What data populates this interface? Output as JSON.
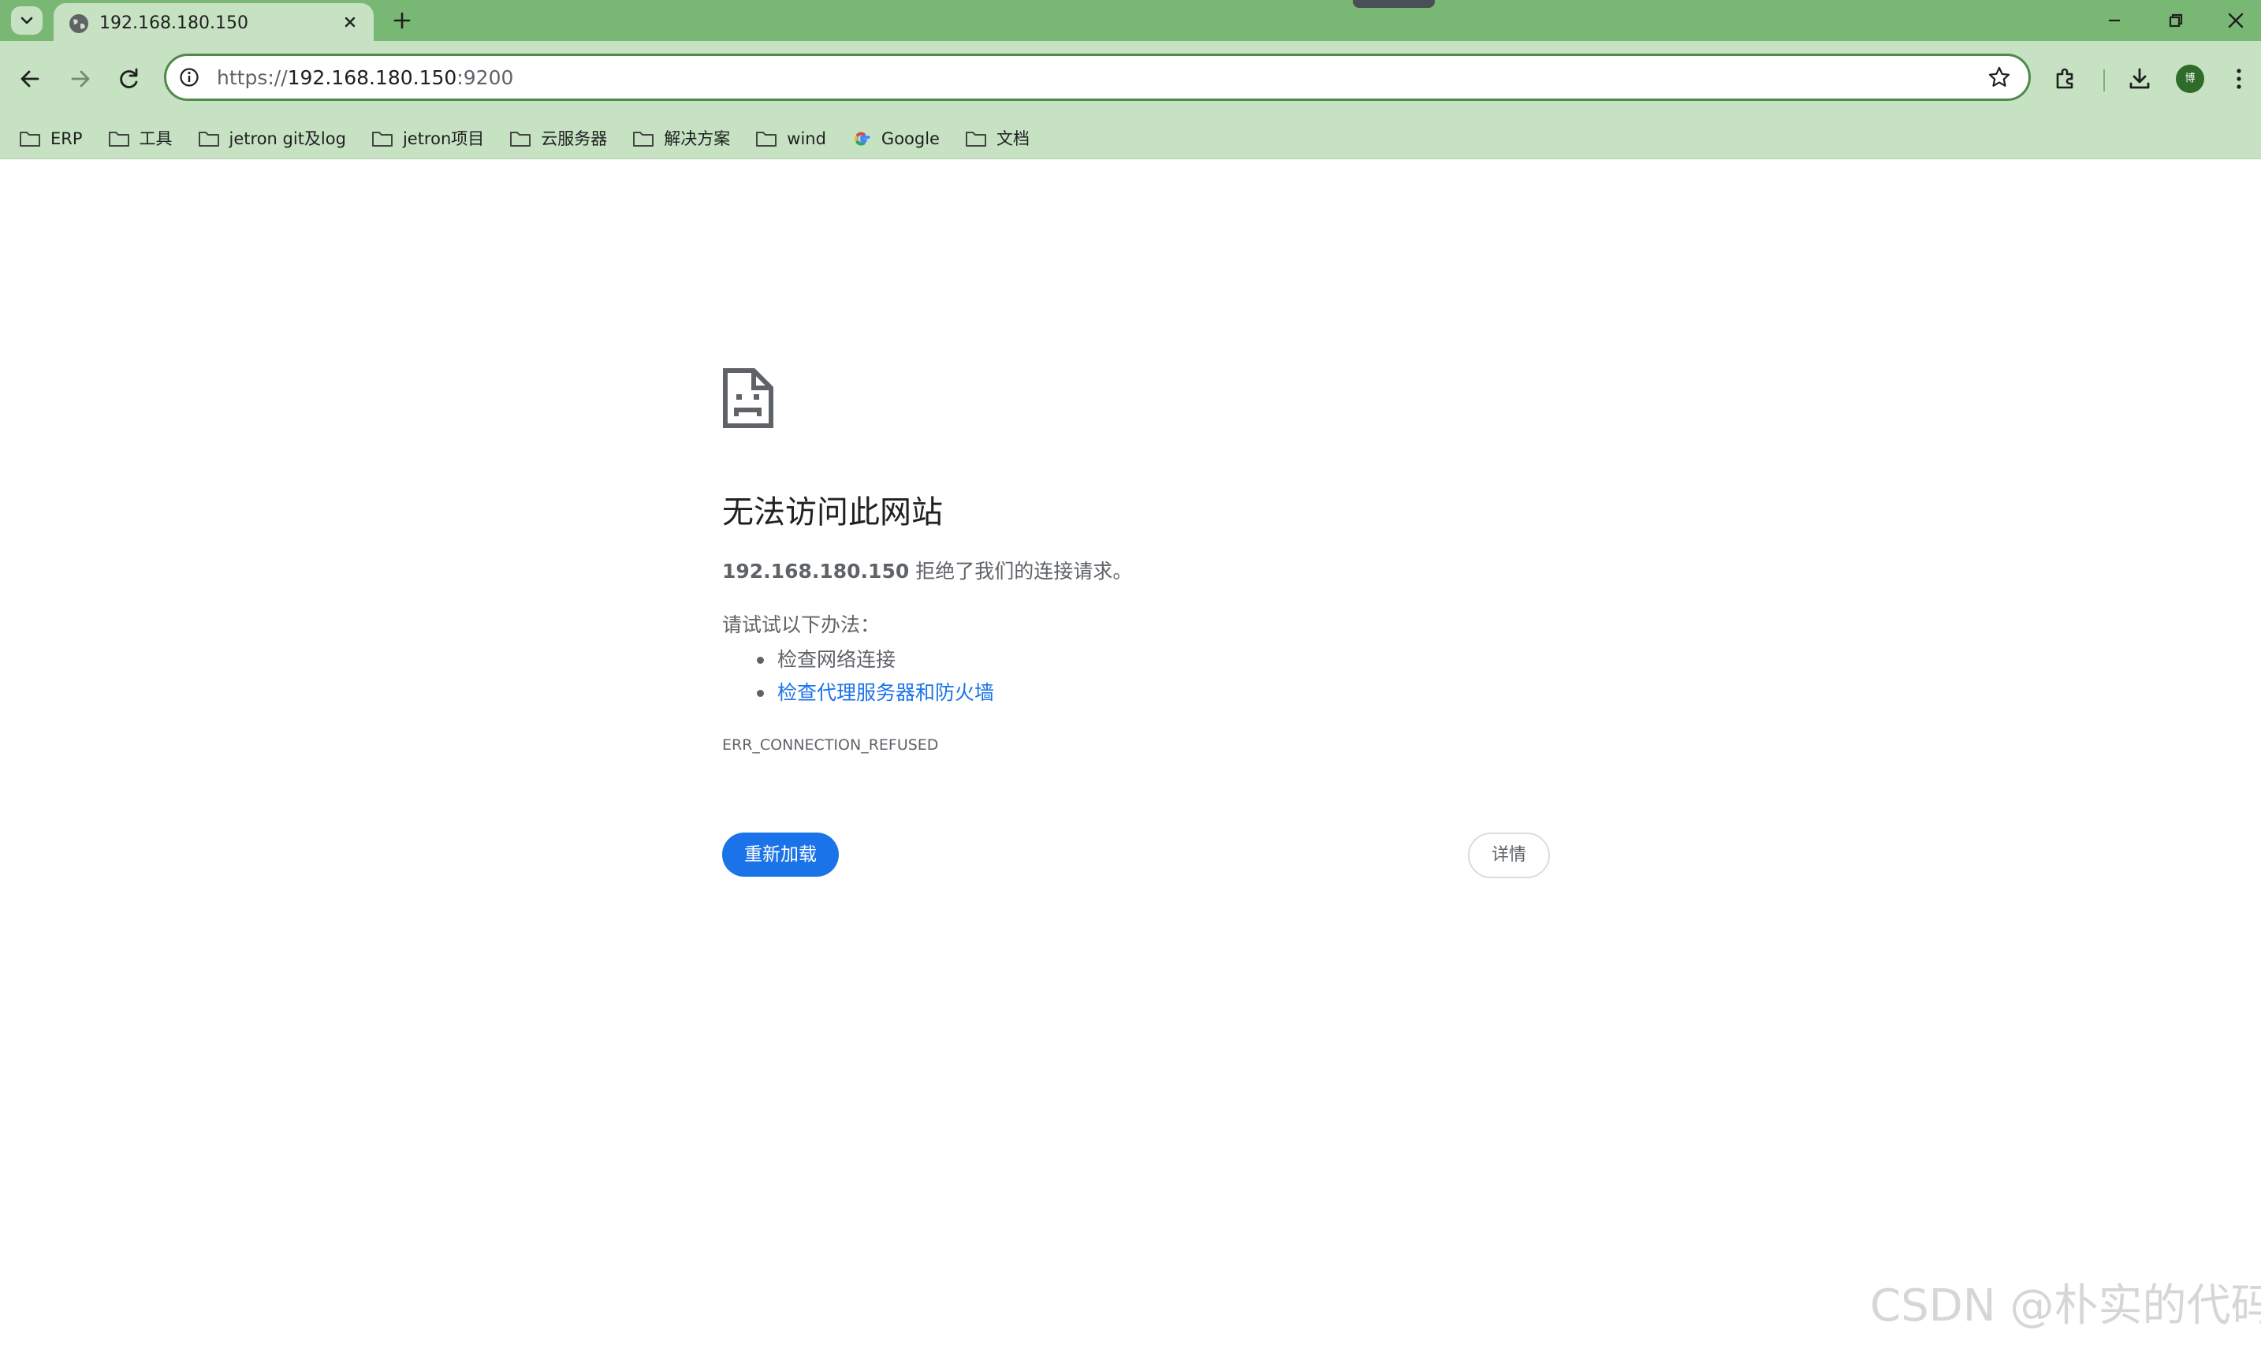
{
  "browser": {
    "tab": {
      "title": "192.168.180.150",
      "favicon": "globe-icon"
    },
    "address_bar": {
      "scheme": "https://",
      "host": "192.168.180.150",
      "port": ":9200"
    },
    "avatar_initial": "博",
    "colors": {
      "frame": "#79b874",
      "toolbar": "#c6e2c3",
      "accent": "#1a73e8"
    }
  },
  "bookmarks": [
    {
      "label": "ERP",
      "icon": "folder-icon"
    },
    {
      "label": "工具",
      "icon": "folder-icon"
    },
    {
      "label": "jetron git及log",
      "icon": "folder-icon"
    },
    {
      "label": "jetron项目",
      "icon": "folder-icon"
    },
    {
      "label": "云服务器",
      "icon": "folder-icon"
    },
    {
      "label": "解决方案",
      "icon": "folder-icon"
    },
    {
      "label": "wind",
      "icon": "folder-icon"
    },
    {
      "label": "Google",
      "icon": "google-icon"
    },
    {
      "label": "文档",
      "icon": "folder-icon"
    }
  ],
  "error": {
    "heading": "无法访问此网站",
    "host": "192.168.180.150",
    "description": "拒绝了我们的连接请求。",
    "suggestions_label": "请试试以下办法：",
    "suggestions": [
      {
        "text": "检查网络连接",
        "link": false
      },
      {
        "text": "检查代理服务器和防火墙",
        "link": true
      }
    ],
    "code": "ERR_CONNECTION_REFUSED",
    "reload_label": "重新加载",
    "details_label": "详情"
  },
  "watermark": "CSDN @朴实的代码"
}
